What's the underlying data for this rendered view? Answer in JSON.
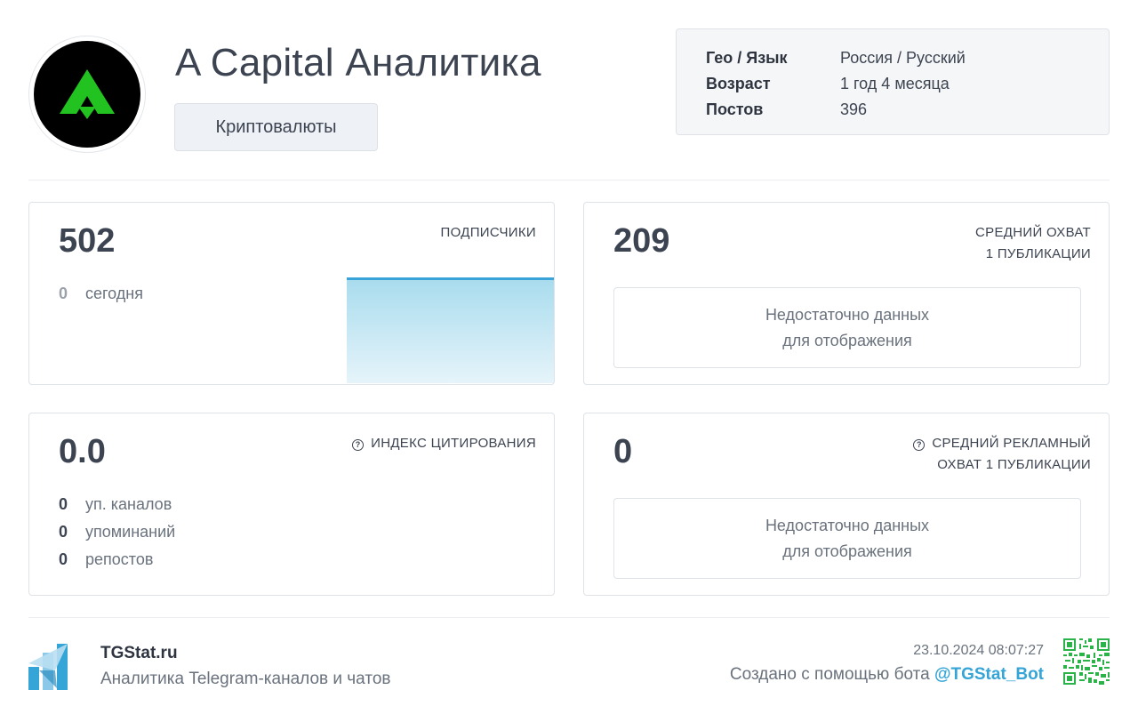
{
  "header": {
    "channel_title": "A Capital Аналитика",
    "category": "Криптовалюты",
    "avatar_icon": "a-capital-logo-icon"
  },
  "info": {
    "rows": [
      {
        "key": "Гео / Язык",
        "value": "Россия / Русский"
      },
      {
        "key": "Возраст",
        "value": "1 год 4 месяца"
      },
      {
        "key": "Постов",
        "value": "396"
      }
    ]
  },
  "cards": {
    "subscribers": {
      "value": "502",
      "label": "ПОДПИСЧИКИ",
      "today_count": "0",
      "today_label": "сегодня"
    },
    "avg_reach": {
      "value": "209",
      "label_line1": "СРЕДНИЙ ОХВАТ",
      "label_line2": "1 ПУБЛИКАЦИИ",
      "nodata_line1": "Недостаточно данных",
      "nodata_line2": "для отображения"
    },
    "citation": {
      "value": "0.0",
      "label": "ИНДЕКС ЦИТИРОВАНИЯ",
      "stats": [
        {
          "num": "0",
          "text": "уп. каналов"
        },
        {
          "num": "0",
          "text": "упоминаний"
        },
        {
          "num": "0",
          "text": "репостов"
        }
      ]
    },
    "ad_reach": {
      "value": "0",
      "label_line1": "СРЕДНИЙ РЕКЛАМНЫЙ",
      "label_line2": "ОХВАТ 1 ПУБЛИКАЦИИ",
      "nodata_line1": "Недостаточно данных",
      "nodata_line2": "для отображения"
    }
  },
  "footer": {
    "brand": "TGStat.ru",
    "tagline": "Аналитика Telegram-каналов и чатов",
    "timestamp": "23.10.2024 08:07:27",
    "created_prefix": "Создано с помощью бота ",
    "bot_handle": "@TGStat_Bot"
  },
  "colors": {
    "accent": "#35a4d6",
    "logo_green": "#22c320",
    "chart_line": "#3aa3d8"
  }
}
